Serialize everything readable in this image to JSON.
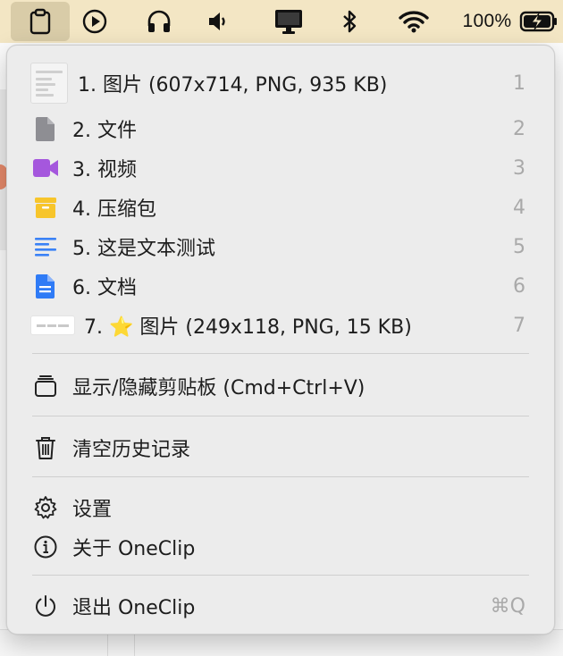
{
  "menubar": {
    "battery_percent": "100%",
    "icons": [
      "clipboard-icon",
      "play-circle-icon",
      "headphones-icon",
      "speaker-icon",
      "display-icon",
      "bluetooth-icon",
      "wifi-icon",
      "battery-charging-icon"
    ]
  },
  "history": [
    {
      "label": "1. 图片 (607x714, PNG, 935 KB)",
      "shortcut": "1",
      "icon": "image-thumbnail"
    },
    {
      "label": "2. 文件",
      "shortcut": "2",
      "icon": "file-icon",
      "color": "#8e8e93"
    },
    {
      "label": "3. 视频",
      "shortcut": "3",
      "icon": "video-icon",
      "color": "#a557dd"
    },
    {
      "label": "4. 压缩包",
      "shortcut": "4",
      "icon": "archive-icon",
      "color": "#f7c52b"
    },
    {
      "label": "5. 这是文本测试",
      "shortcut": "5",
      "icon": "text-lines-icon",
      "color": "#3b82f6"
    },
    {
      "label": "6. 文档",
      "shortcut": "6",
      "icon": "document-icon",
      "color": "#2f7bf6"
    },
    {
      "label": "7. ⭐ 图片 (249x118, PNG, 15 KB)",
      "shortcut": "7",
      "icon": "image-thumbnail"
    }
  ],
  "actions": {
    "toggle": "显示/隐藏剪贴板 (Cmd+Ctrl+V)",
    "clear": "清空历史记录",
    "settings": "设置",
    "about": "关于 OneClip",
    "quit": "退出 OneClip",
    "quit_shortcut": "⌘Q"
  }
}
